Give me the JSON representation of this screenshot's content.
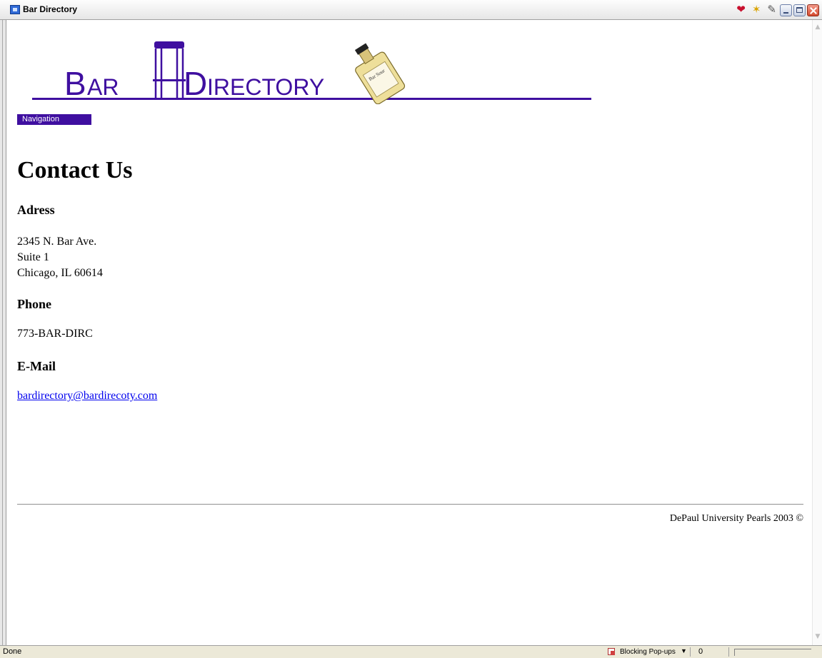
{
  "window": {
    "title": "Bar Directory",
    "toolbar_icons": [
      "heart-icon",
      "favorites-star-icon",
      "edit-note-icon"
    ]
  },
  "logo": {
    "word1_first": "B",
    "word1_rest": "AR",
    "word2_first": "D",
    "word2_rest": "IRECTORY",
    "bottle_label": "Bar Sour",
    "brand_color": "#3f0fa0"
  },
  "nav": {
    "label": "Navigation"
  },
  "page": {
    "title": "Contact Us",
    "address_heading": "Adress",
    "address_lines": [
      "2345 N. Bar Ave.",
      "Suite 1",
      "Chicago, IL 60614"
    ],
    "phone_heading": "Phone",
    "phone": "773-BAR-DIRC",
    "email_heading": "E-Mail",
    "email": "bardirectory@bardirecoty.com",
    "footer": "DePaul University Pearls 2003 ©"
  },
  "statusbar": {
    "status": "Done",
    "popup": "Blocking Pop-ups",
    "zone": "0"
  }
}
